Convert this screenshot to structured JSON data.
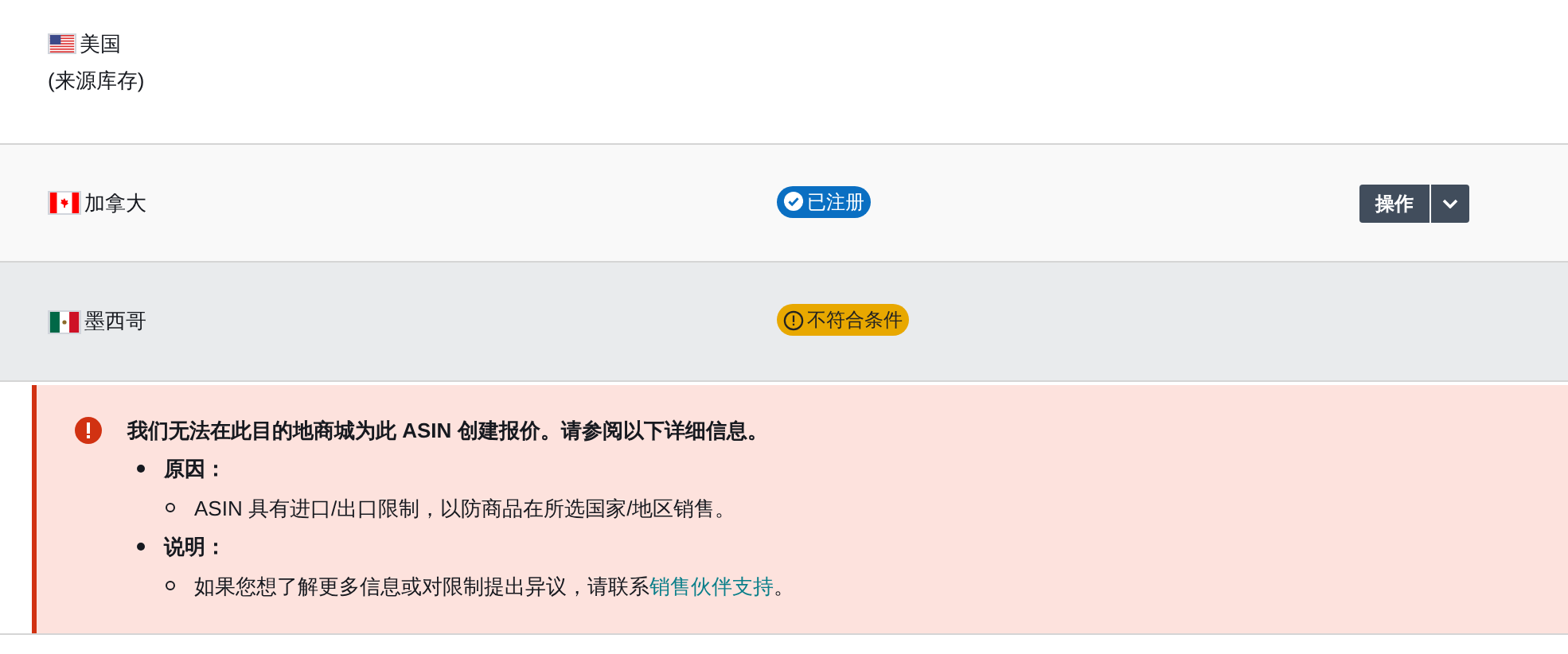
{
  "rows": [
    {
      "kind": "us",
      "country": "美国",
      "note": "(来源库存)"
    },
    {
      "kind": "ca",
      "country": "加拿大",
      "badge": {
        "kind": "registered",
        "label": "已注册"
      },
      "action": {
        "label": "操作"
      }
    },
    {
      "kind": "mx",
      "country": "墨西哥",
      "badge": {
        "kind": "ineligible",
        "label": "不符合条件"
      }
    }
  ],
  "alert": {
    "title": "我们无法在此目的地商城为此 ASIN 创建报价。请参阅以下详细信息。",
    "items": [
      {
        "label": "原因：",
        "sub": [
          {
            "text": "ASIN 具有进口/出口限制，以防商品在所选国家/地区销售。"
          }
        ]
      },
      {
        "label": "说明：",
        "sub": [
          {
            "text": "如果您想了解更多信息或对限制提出异议，请联系",
            "link": "销售伙伴支持",
            "after": "。"
          }
        ]
      }
    ]
  }
}
